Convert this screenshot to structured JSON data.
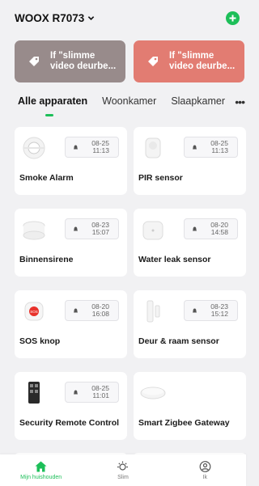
{
  "header": {
    "home_name": "WOOX R7073"
  },
  "scenes": [
    {
      "label_line1": "If \"slimme",
      "label_line2": "video deurbe...",
      "color": "#988b8b"
    },
    {
      "label_line1": "If \"slimme",
      "label_line2": "video deurbe...",
      "color": "#e27c72"
    }
  ],
  "tabs": [
    "Alle apparaten",
    "Woonkamer",
    "Slaapkamer"
  ],
  "devices": [
    {
      "name": "Smoke Alarm",
      "date": "08-25",
      "time": "11:13",
      "icon": "smoke-alarm-icon"
    },
    {
      "name": "PIR sensor",
      "date": "08-25",
      "time": "11:13",
      "icon": "pir-sensor-icon"
    },
    {
      "name": "Binnensirene",
      "date": "08-23",
      "time": "15:07",
      "icon": "siren-icon"
    },
    {
      "name": "Water leak sensor",
      "date": "08-20",
      "time": "14:58",
      "icon": "water-leak-icon"
    },
    {
      "name": "SOS knop",
      "date": "08-20",
      "time": "16:08",
      "icon": "sos-button-icon"
    },
    {
      "name": "Deur & raam sensor",
      "date": "08-23",
      "time": "15:12",
      "icon": "door-sensor-icon"
    },
    {
      "name": "Security Remote Control",
      "date": "08-25",
      "time": "11:01",
      "icon": "remote-control-icon"
    },
    {
      "name": "Smart Zigbee Gateway",
      "icon": "gateway-icon"
    }
  ],
  "bottom_nav": [
    {
      "label": "Mijn huishouden",
      "icon": "home-icon",
      "active": true
    },
    {
      "label": "Slim",
      "icon": "smart-icon",
      "active": false
    },
    {
      "label": "Ik",
      "icon": "profile-icon",
      "active": false
    }
  ],
  "colors": {
    "accent": "#1dbf59"
  }
}
